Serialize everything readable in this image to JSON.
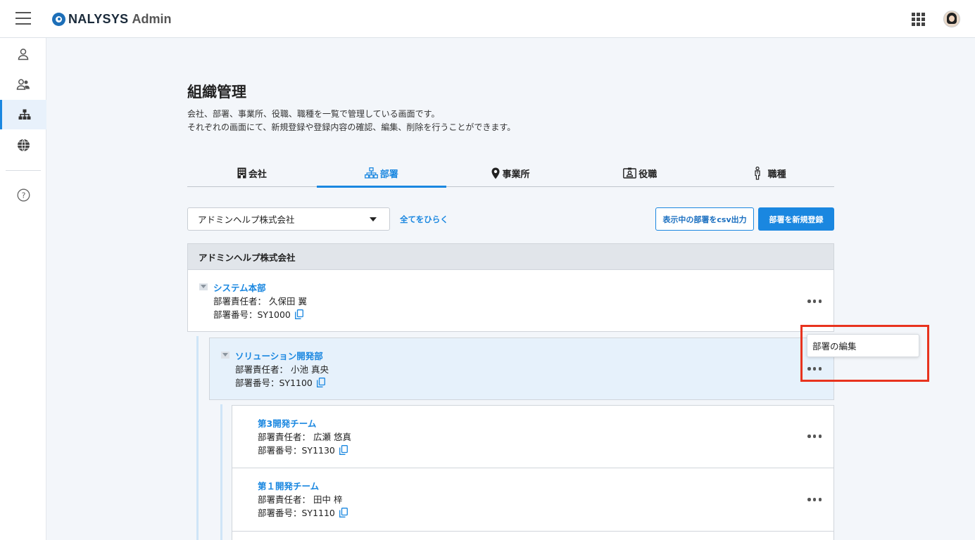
{
  "header": {
    "brand": "NALYSYS",
    "brand_sub": "Admin"
  },
  "rail": {
    "items": [
      {
        "name": "user-icon"
      },
      {
        "name": "users-icon"
      },
      {
        "name": "org-chart-icon",
        "active": true
      },
      {
        "name": "globe-icon"
      },
      {
        "name": "help-icon"
      }
    ]
  },
  "page": {
    "title": "組織管理",
    "desc_line1": "会社、部署、事業所、役職、職種を一覧で管理している画面です。",
    "desc_line2": "それぞれの画面にて、新規登録や登録内容の確認、編集、削除を行うことができます。"
  },
  "tabs": [
    {
      "label": "会社",
      "icon": "building-icon"
    },
    {
      "label": "部署",
      "icon": "org-chart-icon",
      "active": true
    },
    {
      "label": "事業所",
      "icon": "location-pin-icon"
    },
    {
      "label": "役職",
      "icon": "id-card-icon"
    },
    {
      "label": "職種",
      "icon": "person-icon"
    }
  ],
  "toolbar": {
    "company_select": "アドミンヘルプ株式会社",
    "open_all": "全てをひらく",
    "csv_button": "表示中の部署をcsv出力",
    "new_button": "部署を新規登録"
  },
  "company_header": "アドミンヘルプ株式会社",
  "departments": [
    {
      "name": "システム本部",
      "manager": "部署責任者： 久保田 翼",
      "code": "部署番号：SY1000"
    },
    {
      "name": "ソリューション開発部",
      "manager": "部署責任者： 小池 真央",
      "code": "部署番号：SY1100"
    },
    {
      "name": "第3開発チーム",
      "manager": "部署責任者： 広瀬 悠真",
      "code": "部署番号：SY1130"
    },
    {
      "name": "第１開発チーム",
      "manager": "部署責任者： 田中 梓",
      "code": "部署番号：SY1110"
    }
  ],
  "popup": {
    "label": "部署の編集"
  },
  "colors": {
    "accent": "#1a87e0",
    "highlight": "#e8331e"
  }
}
